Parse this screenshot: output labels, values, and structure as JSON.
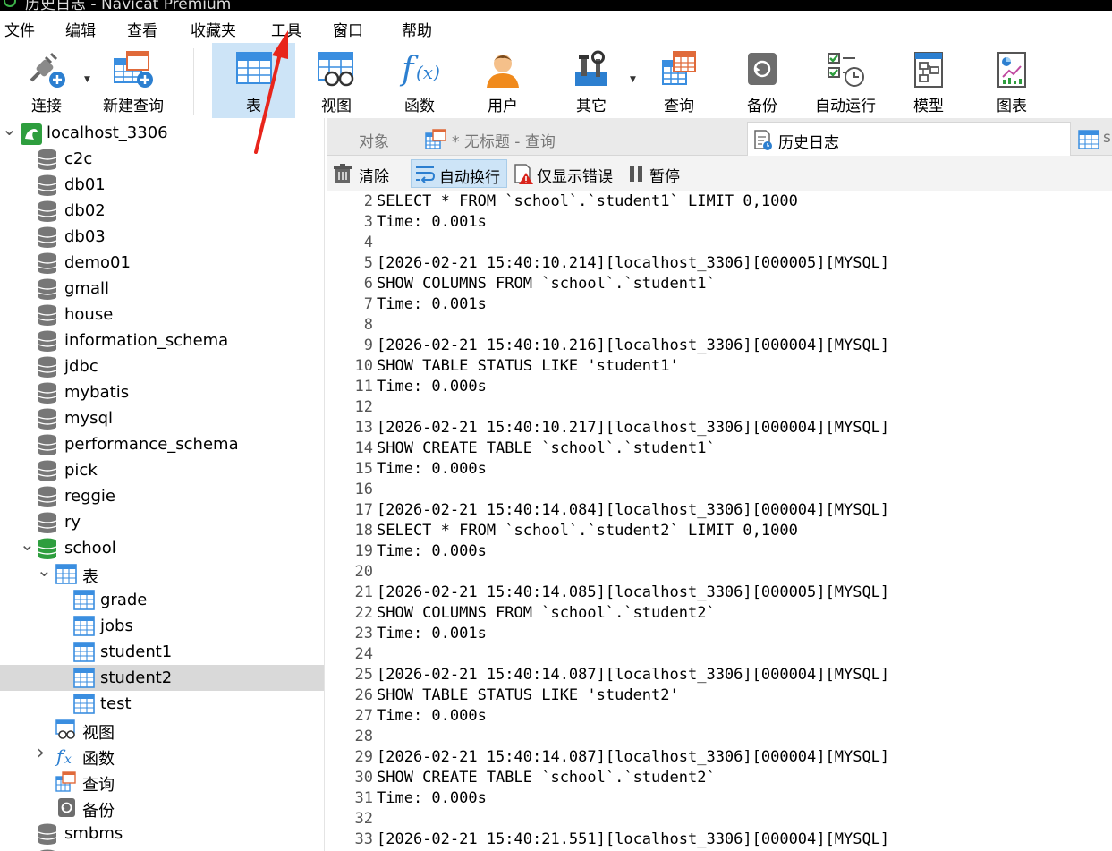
{
  "window": {
    "title": "历史日志 - Navicat Premium"
  },
  "menu": [
    "文件",
    "编辑",
    "查看",
    "收藏夹",
    "工具",
    "窗口",
    "帮助"
  ],
  "toolbar": {
    "connect": "连接",
    "new_query": "新建查询",
    "table": "表",
    "view": "视图",
    "function": "函数",
    "user": "用户",
    "other": "其它",
    "query": "查询",
    "backup": "备份",
    "automation": "自动运行",
    "model": "模型",
    "chart": "图表"
  },
  "tree": {
    "connection": "localhost_3306",
    "databases_before": [
      "c2c",
      "db01",
      "db02",
      "db03",
      "demo01",
      "gmall",
      "house",
      "information_schema",
      "jdbc",
      "mybatis",
      "mysql",
      "performance_schema",
      "pick",
      "reggie",
      "ry"
    ],
    "open_db": "school",
    "tables_group": "表",
    "tables": [
      "grade",
      "jobs",
      "student1",
      "student2",
      "test"
    ],
    "selected_table": "student2",
    "views_group": "视图",
    "functions_group": "函数",
    "queries_group": "查询",
    "backups_group": "备份",
    "databases_after": [
      "smbms"
    ]
  },
  "tabs": {
    "objects": "对象",
    "untitled_query": "* 无标题 - 查询",
    "history_log": "历史日志",
    "extra": "s"
  },
  "log_toolbar": {
    "clear": "清除",
    "word_wrap": "自动换行",
    "errors_only": "仅显示错误",
    "pause": "暂停"
  },
  "log_lines": [
    {
      "n": "2",
      "text": "SELECT * FROM `school`.`student1` LIMIT 0,1000"
    },
    {
      "n": "3",
      "text": "Time: 0.001s"
    },
    {
      "n": "4",
      "text": ""
    },
    {
      "n": "5",
      "text": "[2026-02-21 15:40:10.214][localhost_3306][000005][MYSQL]"
    },
    {
      "n": "6",
      "text": "SHOW COLUMNS FROM `school`.`student1`"
    },
    {
      "n": "7",
      "text": "Time: 0.001s"
    },
    {
      "n": "8",
      "text": ""
    },
    {
      "n": "9",
      "text": "[2026-02-21 15:40:10.216][localhost_3306][000004][MYSQL]"
    },
    {
      "n": "10",
      "text": "SHOW TABLE STATUS LIKE 'student1'"
    },
    {
      "n": "11",
      "text": "Time: 0.000s"
    },
    {
      "n": "12",
      "text": ""
    },
    {
      "n": "13",
      "text": "[2026-02-21 15:40:10.217][localhost_3306][000004][MYSQL]"
    },
    {
      "n": "14",
      "text": "SHOW CREATE TABLE `school`.`student1`"
    },
    {
      "n": "15",
      "text": "Time: 0.000s"
    },
    {
      "n": "16",
      "text": ""
    },
    {
      "n": "17",
      "text": "[2026-02-21 15:40:14.084][localhost_3306][000004][MYSQL]"
    },
    {
      "n": "18",
      "text": "SELECT * FROM `school`.`student2` LIMIT 0,1000"
    },
    {
      "n": "19",
      "text": "Time: 0.000s"
    },
    {
      "n": "20",
      "text": ""
    },
    {
      "n": "21",
      "text": "[2026-02-21 15:40:14.085][localhost_3306][000005][MYSQL]"
    },
    {
      "n": "22",
      "text": "SHOW COLUMNS FROM `school`.`student2`"
    },
    {
      "n": "23",
      "text": "Time: 0.001s"
    },
    {
      "n": "24",
      "text": ""
    },
    {
      "n": "25",
      "text": "[2026-02-21 15:40:14.087][localhost_3306][000004][MYSQL]"
    },
    {
      "n": "26",
      "text": "SHOW TABLE STATUS LIKE 'student2'"
    },
    {
      "n": "27",
      "text": "Time: 0.000s"
    },
    {
      "n": "28",
      "text": ""
    },
    {
      "n": "29",
      "text": "[2026-02-21 15:40:14.087][localhost_3306][000004][MYSQL]"
    },
    {
      "n": "30",
      "text": "SHOW CREATE TABLE `school`.`student2`"
    },
    {
      "n": "31",
      "text": "Time: 0.000s"
    },
    {
      "n": "32",
      "text": ""
    },
    {
      "n": "33",
      "text": "[2026-02-21 15:40:21.551][localhost_3306][000004][MYSQL]"
    }
  ],
  "colors": {
    "active_tool_bg": "#cde4f7",
    "selected_row_bg": "#d9d9d9",
    "annotation_arrow": "#e8251b",
    "db_icon": "#777777",
    "open_db_icon": "#2e9e3e",
    "table_icon": "#3a8ee0"
  }
}
